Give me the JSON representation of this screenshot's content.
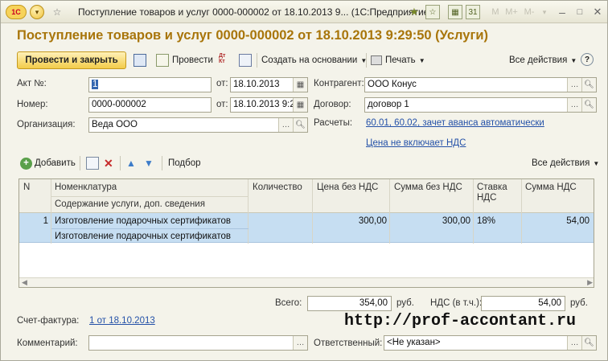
{
  "titlebar": {
    "logo": "1С",
    "title": "Поступление товаров и услуг 0000-000002 от 18.10.2013 9...   (1С:Предприятие)",
    "memory_buttons": [
      "M",
      "M+",
      "M-"
    ]
  },
  "heading": "Поступление товаров и услуг 0000-000002 от 18.10.2013 9:29:50 (Услуги)",
  "toolbar": {
    "post_close": "Провести и закрыть",
    "post": "Провести",
    "dt_kt": "Дт Кт",
    "create_based": "Создать на основании",
    "print": "Печать",
    "all_actions": "Все действия"
  },
  "form": {
    "act_label": "Акт №:",
    "act_value": "1",
    "from_label": "от:",
    "act_date": "18.10.2013",
    "number_label": "Номер:",
    "number_value": "0000-000002",
    "number_date": "18.10.2013 9:2",
    "org_label": "Организация:",
    "org_value": "Веда ООО",
    "contractor_label": "Контрагент:",
    "contractor_value": "ООО Конус",
    "contract_label": "Договор:",
    "contract_value": "договор 1",
    "settlements_label": "Расчеты:",
    "settlements_link": "60.01, 60.02, зачет аванса автоматически",
    "vat_link": "Цена не включает НДС"
  },
  "table_toolbar": {
    "add": "Добавить",
    "pick": "Подбор",
    "all_actions": "Все действия"
  },
  "table": {
    "headers": {
      "n": "N",
      "nomenclature": "Номенклатура",
      "content": "Содержание услуги, доп. сведения",
      "qty": "Количество",
      "price": "Цена без НДС",
      "sum": "Сумма без НДС",
      "rate": "Ставка НДС",
      "vat_sum": "Сумма НДС"
    },
    "rows": [
      {
        "n": "1",
        "nomenclature": "Изготовление подарочных сертификатов",
        "content": "Изготовление подарочных сертификатов",
        "qty": "",
        "price": "300,00",
        "sum": "300,00",
        "rate": "18%",
        "vat_sum": "54,00"
      }
    ]
  },
  "totals": {
    "total_label": "Всего:",
    "total_value": "354,00",
    "currency": "руб.",
    "vat_label": "НДС (в т.ч.):",
    "vat_value": "54,00"
  },
  "footer": {
    "invoice_label": "Счет-фактура:",
    "invoice_link": "1 от 18.10.2013",
    "comment_label": "Комментарий:",
    "comment_value": "",
    "responsible_label": "Ответственный:",
    "responsible_value": "<Не указан>",
    "watermark": "http://prof-accontant.ru"
  },
  "colors": {
    "heading": "#a8750a",
    "accent_button": "#f3cc4a",
    "selected_row": "#c6def2",
    "link": "#2451a8"
  }
}
